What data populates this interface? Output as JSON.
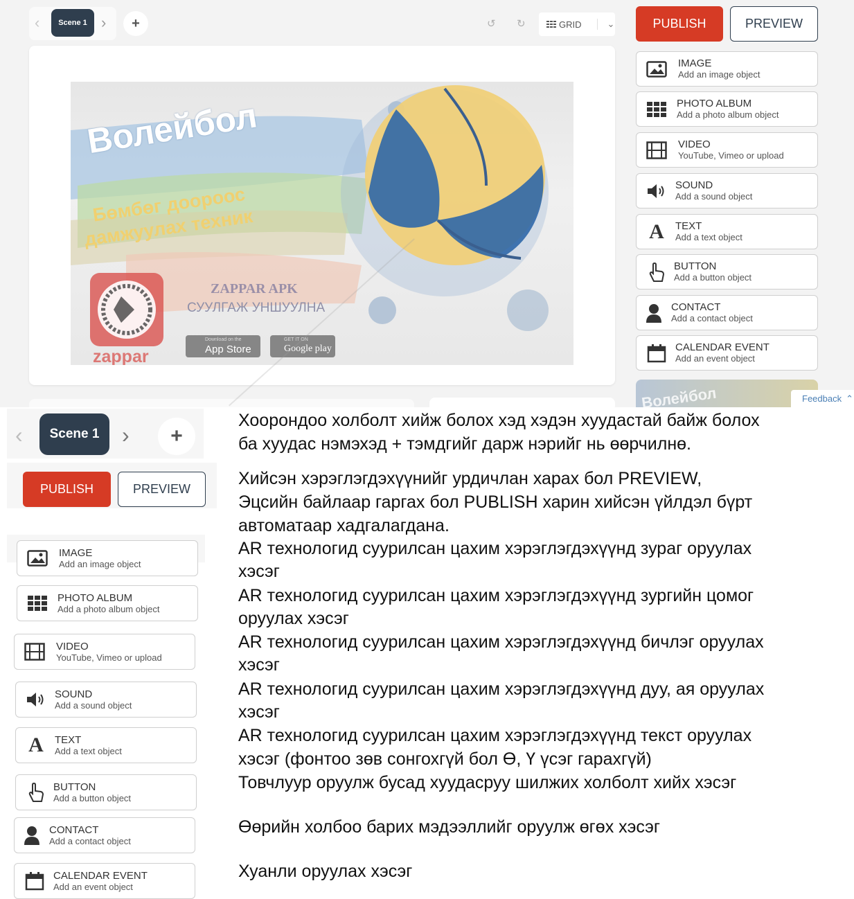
{
  "editor": {
    "scene_label": "Scene 1",
    "grid_label": "GRID",
    "publish_label": "PUBLISH",
    "preview_label": "PREVIEW",
    "feedback_label": "Feedback",
    "poster": {
      "title": "Волейбол",
      "subtitle_line1": "Бөмбөг доороос",
      "subtitle_line2": "дамжуулах техник",
      "zappar_apk": "ZAPPAR APK",
      "scan_text": "СУУЛГАЖ УНШУУЛНА",
      "zappar_logo": "zappar",
      "appstore_small": "Download on the",
      "appstore": "App Store",
      "googleplay_small": "GET IT ON",
      "googleplay": "Google play"
    },
    "thumb_text": "Волейбол",
    "objects": [
      {
        "title": "IMAGE",
        "subtitle": "Add an image object",
        "icon": "image-icon"
      },
      {
        "title": "PHOTO ALBUM",
        "subtitle": "Add a photo album object",
        "icon": "photo-album-icon"
      },
      {
        "title": "VIDEO",
        "subtitle": "YouTube, Vimeo or upload",
        "icon": "film-icon"
      },
      {
        "title": "SOUND",
        "subtitle": "Add a sound object",
        "icon": "speaker-icon"
      },
      {
        "title": "TEXT",
        "subtitle": "Add a text object",
        "icon": "letter-a-icon"
      },
      {
        "title": "BUTTON",
        "subtitle": "Add a button object",
        "icon": "pointer-hand-icon"
      },
      {
        "title": "CONTACT",
        "subtitle": "Add a contact object",
        "icon": "person-icon"
      },
      {
        "title": "CALENDAR EVENT",
        "subtitle": "Add an event object",
        "icon": "calendar-icon"
      }
    ]
  },
  "left_panel": {
    "scene_label": "Scene 1",
    "publish_label": "PUBLISH",
    "preview_label": "PREVIEW"
  },
  "descriptions": [
    "Хоорондоо холболт хийж болох хэд хэдэн хуудастай байж болох",
    "ба хуудас нэмэхэд + тэмдгийг дарж нэрийг нь өөрчилнө.",
    "Хийсэн хэрэглэгдэхүүнийг урдичлан харах бол PREVIEW,",
    "Эцсийн байлаар гаргах бол PUBLISH харин хийсэн үйлдэл бүрт",
    "автоматаар хадгалагдана.",
    "AR технологид суурилсан цахим хэрэглэгдэхүүнд зураг оруулах",
    "хэсэг",
    "AR технологид суурилсан цахим хэрэглэгдэхүүнд зургийн цомог",
    "оруулах хэсэг",
    "AR технологид суурилсан цахим хэрэглэгдэхүүнд бичлэг оруулах",
    "хэсэг",
    "AR технологид суурилсан цахим хэрэглэгдэхүүнд дуу, ая оруулах",
    "хэсэг",
    "AR технологид суурилсан цахим хэрэглэгдэхүүнд текст оруулах",
    "хэсэг (фонтоо зөв сонгохгүй бол Ө, Ү үсэг гарахгүй)",
    "Товчлуур оруулж бусад хуудасруу шилжих холболт хийх хэсэг",
    "Өөрийн холбоо барих мэдээллийг оруулж өгөх хэсэг",
    "Хуанли оруулах хэсэг"
  ],
  "colors": {
    "publish": "#d63b25",
    "navy": "#2f3e4e"
  }
}
